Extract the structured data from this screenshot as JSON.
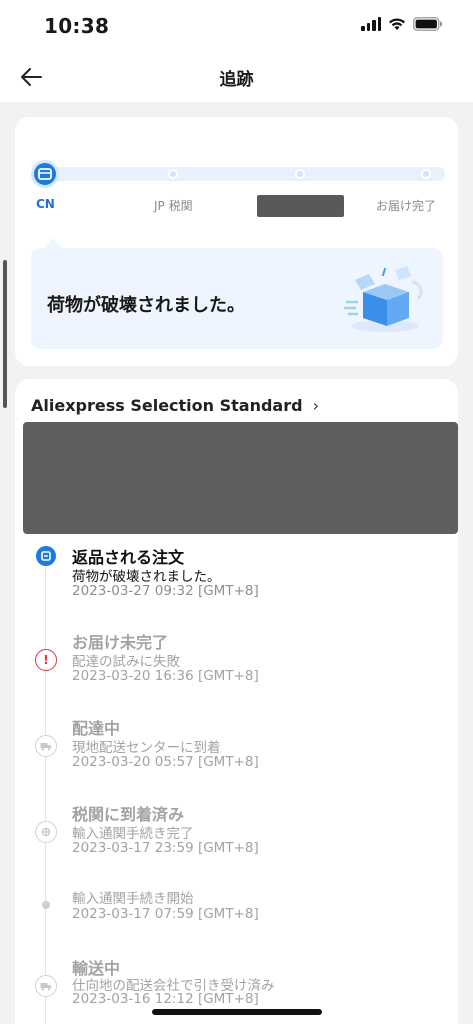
{
  "status_bar": {
    "time": "10:38"
  },
  "nav": {
    "title": "追跡"
  },
  "progress": {
    "steps": [
      {
        "label": "CN",
        "state": "current"
      },
      {
        "label": "JP 税関",
        "state": "pending"
      },
      {
        "label": "",
        "state": "pending"
      },
      {
        "label": "お届け完了",
        "state": "pending"
      }
    ],
    "message": "荷物が破壊されました。"
  },
  "tracking": {
    "carrier": "Aliexpress Selection Standard",
    "events": [
      {
        "title": "返品される注文",
        "desc": "荷物が破壊されました。",
        "date": "2023-03-27 09:32 [GMT+8]",
        "icon": "return-icon"
      },
      {
        "title": "お届け未完了",
        "desc": "配達の試みに失敗",
        "date": "2023-03-20 16:36 [GMT+8]",
        "icon": "alert-icon"
      },
      {
        "title": "配達中",
        "desc": "現地配送センターに到着",
        "date": "2023-03-20 05:57 [GMT+8]",
        "icon": "truck-icon"
      },
      {
        "title": "税関に到着済み",
        "desc": "輸入通関手続き完了",
        "date": "2023-03-17 23:59 [GMT+8]",
        "icon": "customs-icon"
      },
      {
        "title": "",
        "desc": "輸入通関手続き開始",
        "date": "2023-03-17 07:59 [GMT+8]",
        "icon": "dot-icon"
      },
      {
        "title": "輸送中",
        "desc": "仕向地の配送会社で引き受け済み",
        "date": "2023-03-16 12:12 [GMT+8]",
        "icon": "truck-icon"
      }
    ]
  },
  "colors": {
    "accent": "#1f7ae0",
    "alert": "#d9363e",
    "muted": "#a3a3a3"
  }
}
